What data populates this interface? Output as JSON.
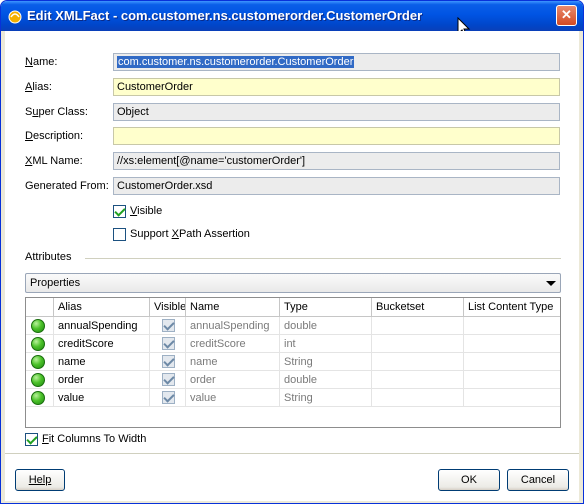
{
  "window": {
    "title": "Edit XMLFact - com.customer.ns.customerorder.CustomerOrder",
    "close_glyph": "✕"
  },
  "form": {
    "name": {
      "label": "Name:",
      "value": "com.customer.ns.customerorder.CustomerOrder"
    },
    "alias": {
      "label": "Alias:",
      "value": "CustomerOrder"
    },
    "super_class": {
      "label": "Super Class:",
      "value": "Object"
    },
    "description": {
      "label": "Description:",
      "value": ""
    },
    "xml_name": {
      "label": "XML Name:",
      "value": "//xs:element[@name='customerOrder']"
    },
    "generated_from": {
      "label": "Generated From:",
      "value": "CustomerOrder.xsd"
    },
    "visible": {
      "label": "Visible",
      "checked": true
    },
    "support_xpath": {
      "label": "Support XPath Assertion",
      "checked": false
    }
  },
  "attributes": {
    "section_label": "Attributes",
    "dropdown_value": "Properties",
    "columns": [
      "Alias",
      "Visible",
      "Name",
      "Type",
      "Bucketset",
      "List Content Type"
    ],
    "rows": [
      {
        "alias": "annualSpending",
        "visible": true,
        "name": "annualSpending",
        "type": "double",
        "bucketset": "",
        "list_content_type": ""
      },
      {
        "alias": "creditScore",
        "visible": true,
        "name": "creditScore",
        "type": "int",
        "bucketset": "",
        "list_content_type": ""
      },
      {
        "alias": "name",
        "visible": true,
        "name": "name",
        "type": "String",
        "bucketset": "",
        "list_content_type": ""
      },
      {
        "alias": "order",
        "visible": true,
        "name": "order",
        "type": "double",
        "bucketset": "",
        "list_content_type": ""
      },
      {
        "alias": "value",
        "visible": true,
        "name": "value",
        "type": "String",
        "bucketset": "",
        "list_content_type": ""
      }
    ],
    "fit_columns": {
      "label": "Fit Columns To Width",
      "checked": true
    }
  },
  "buttons": {
    "help": "Help",
    "ok": "OK",
    "cancel": "Cancel"
  },
  "colors": {
    "titlebar": "#0054e3",
    "editable_field": "#ffffcc",
    "readonly_field": "#ececec",
    "selection": "#316ac5",
    "status_ok": "#4cc22a"
  },
  "icons": {
    "app": "oracle-fact-icon",
    "status": "green-status-icon",
    "dropdown": "chevron-down-icon",
    "cursor": "mouse-pointer-icon"
  }
}
